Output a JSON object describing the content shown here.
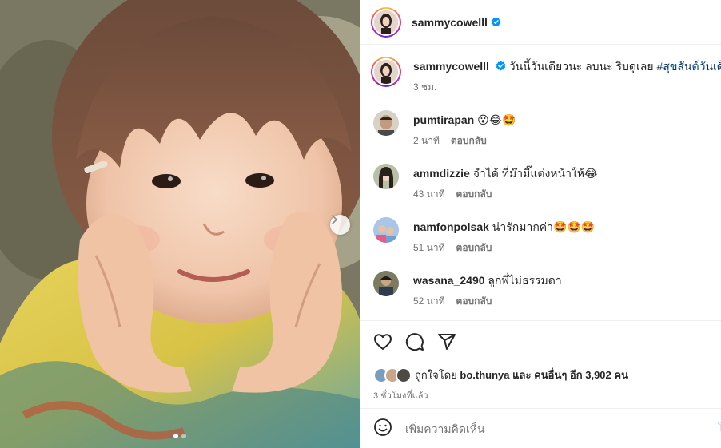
{
  "post": {
    "username": "sammycowelll",
    "verified": true
  },
  "caption": {
    "username": "sammycowelll",
    "text": "วันนี้วันเดียวนะ ลบนะ ริบดูเลย",
    "hashtag": "#สุขสันต์วันเด็ก",
    "time": "3 ชม."
  },
  "comments": [
    {
      "username": "pumtirapan",
      "text": "😮😂🤩",
      "time": "2 นาที",
      "reply": "ตอบกลับ",
      "avatar_color": "#c7a58c"
    },
    {
      "username": "ammdizzie",
      "text": "จำได้ ที่ม๊ามี๊แต่งหน้าให้😂",
      "time": "43 นาที",
      "reply": "ตอบกลับ",
      "avatar_color": "#9fa58f"
    },
    {
      "username": "namfonpolsak",
      "text": "น่ารักมากค่า🤩🤩🤩",
      "time": "51 นาที",
      "reply": "ตอบกลับ",
      "avatar_color": "#8fb0d9"
    },
    {
      "username": "wasana_2490",
      "text": "ลูกพี่ไม่ธรรมดา",
      "time": "52 นาที",
      "reply": "ตอบกลับ",
      "avatar_color": "#6d6a58"
    }
  ],
  "actions": {
    "like_icon": "heart-icon",
    "comment_icon": "comment-icon",
    "share_icon": "send-icon"
  },
  "likes": {
    "prefix": "ถูกใจโดย",
    "user": "bo.thunya",
    "middle": "และ",
    "others": "คนอื่นๆ อีก 3,902 คน",
    "time": "3 ชั่วโมงที่แล้ว"
  },
  "add_comment": {
    "placeholder": "เพิ่มความคิดเห็น",
    "post_label": "โ"
  },
  "carousel": {
    "count": 2,
    "active": 0
  },
  "colors": {
    "verified": "#0095f6",
    "hashtag": "#00376b",
    "secondary_text": "#737373"
  }
}
